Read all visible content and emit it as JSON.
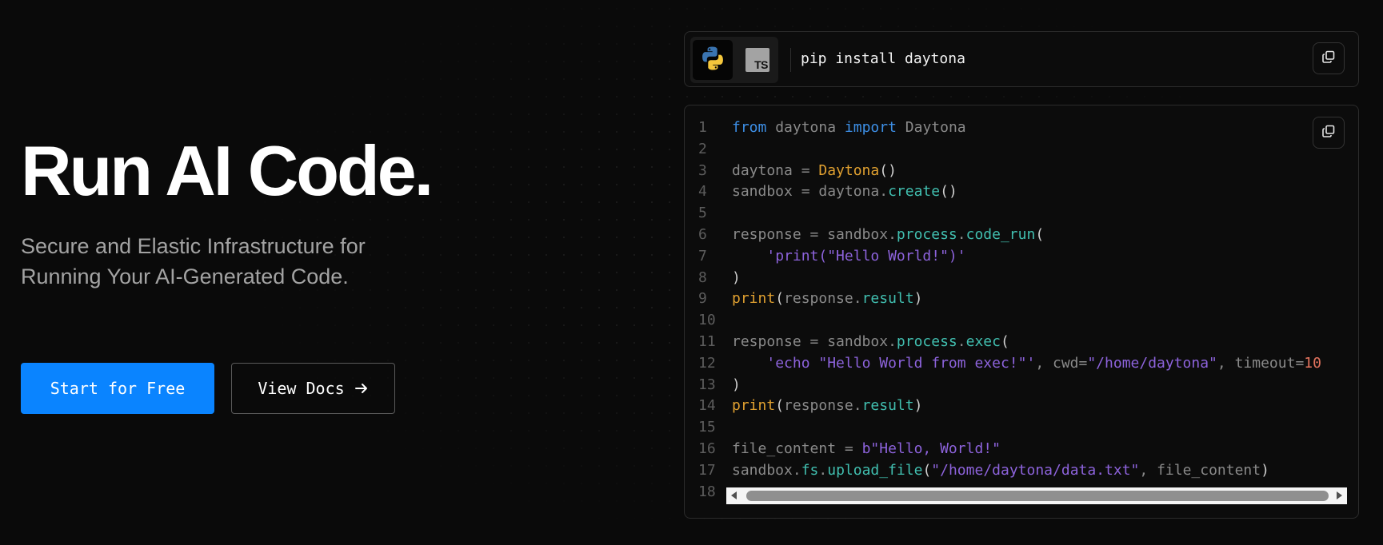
{
  "hero": {
    "title": "Run AI Code.",
    "subtitle": "Secure and Elastic Infrastructure for Running Your AI-Generated Code."
  },
  "buttons": {
    "primary_label": "Start for Free",
    "secondary_label": "View Docs"
  },
  "install": {
    "languages": [
      {
        "label": "Python",
        "icon": "python-logo-icon",
        "selected": true
      },
      {
        "label": "TS",
        "icon": "typescript-logo-icon",
        "selected": false
      }
    ],
    "command": "pip install daytona"
  },
  "code": {
    "lines": [
      {
        "n": "1",
        "tokens": [
          [
            "kw",
            "from"
          ],
          [
            "pl",
            " daytona "
          ],
          [
            "kw",
            "import"
          ],
          [
            "pl",
            " Daytona"
          ]
        ]
      },
      {
        "n": "2",
        "tokens": []
      },
      {
        "n": "3",
        "tokens": [
          [
            "pl",
            "daytona = "
          ],
          [
            "cls",
            "Daytona"
          ],
          [
            "punc",
            "()"
          ]
        ]
      },
      {
        "n": "4",
        "tokens": [
          [
            "pl",
            "sandbox = daytona."
          ],
          [
            "meth",
            "create"
          ],
          [
            "punc",
            "()"
          ]
        ]
      },
      {
        "n": "5",
        "tokens": []
      },
      {
        "n": "6",
        "tokens": [
          [
            "pl",
            "response = sandbox."
          ],
          [
            "meth",
            "process"
          ],
          [
            "pl",
            "."
          ],
          [
            "meth",
            "code_run"
          ],
          [
            "punc",
            "("
          ]
        ]
      },
      {
        "n": "7",
        "tokens": [
          [
            "pl",
            "    "
          ],
          [
            "str",
            "'print(\"Hello World!\")'"
          ]
        ]
      },
      {
        "n": "8",
        "tokens": [
          [
            "punc",
            ")"
          ]
        ]
      },
      {
        "n": "9",
        "tokens": [
          [
            "cls",
            "print"
          ],
          [
            "punc",
            "("
          ],
          [
            "pl",
            "response."
          ],
          [
            "meth",
            "result"
          ],
          [
            "punc",
            ")"
          ]
        ]
      },
      {
        "n": "10",
        "tokens": []
      },
      {
        "n": "11",
        "tokens": [
          [
            "pl",
            "response = sandbox."
          ],
          [
            "meth",
            "process"
          ],
          [
            "pl",
            "."
          ],
          [
            "meth",
            "exec"
          ],
          [
            "punc",
            "("
          ]
        ]
      },
      {
        "n": "12",
        "tokens": [
          [
            "pl",
            "    "
          ],
          [
            "str",
            "'echo \"Hello World from exec!\"'"
          ],
          [
            "pl",
            ", cwd="
          ],
          [
            "str",
            "\"/home/daytona\""
          ],
          [
            "pl",
            ", timeout="
          ],
          [
            "num",
            "10"
          ]
        ]
      },
      {
        "n": "13",
        "tokens": [
          [
            "punc",
            ")"
          ]
        ]
      },
      {
        "n": "14",
        "tokens": [
          [
            "cls",
            "print"
          ],
          [
            "punc",
            "("
          ],
          [
            "pl",
            "response."
          ],
          [
            "meth",
            "result"
          ],
          [
            "punc",
            ")"
          ]
        ]
      },
      {
        "n": "15",
        "tokens": []
      },
      {
        "n": "16",
        "tokens": [
          [
            "pl",
            "file_content = "
          ],
          [
            "str",
            "b\"Hello, World!\""
          ]
        ]
      },
      {
        "n": "17",
        "tokens": [
          [
            "pl",
            "sandbox."
          ],
          [
            "meth",
            "fs"
          ],
          [
            "pl",
            "."
          ],
          [
            "meth",
            "upload_file"
          ],
          [
            "punc",
            "("
          ],
          [
            "str",
            "\"/home/daytona/data.txt\""
          ],
          [
            "pl",
            ", file_content"
          ],
          [
            "punc",
            ")"
          ]
        ]
      },
      {
        "n": "18",
        "tokens": []
      }
    ]
  },
  "colors": {
    "background": "#0a0a0a",
    "primary_button": "#0a84ff",
    "keyword": "#3d8fe6",
    "class_or_builtin": "#e0a030",
    "method": "#41bfb0",
    "string": "#8d63dc",
    "number": "#e3735e"
  }
}
